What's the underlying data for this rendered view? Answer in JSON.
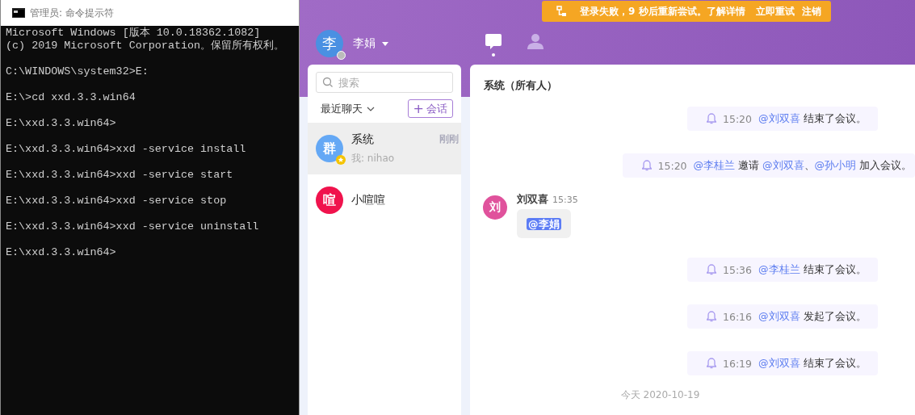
{
  "console": {
    "title": "管理员: 命令提示符",
    "blocks": [
      [
        "Microsoft Windows [版本 10.0.18362.1082]",
        "(c) 2019 Microsoft Corporation。保留所有权利。"
      ],
      [
        "C:\\WINDOWS\\system32>E:"
      ],
      [
        "E:\\>cd xxd.3.3.win64"
      ],
      [
        "E:\\xxd.3.3.win64>"
      ],
      [
        "E:\\xxd.3.3.win64>xxd -service install"
      ],
      [
        "E:\\xxd.3.3.win64>xxd -service start"
      ],
      [
        "E:\\xxd.3.3.win64>xxd -service stop"
      ],
      [
        "E:\\xxd.3.3.win64>xxd -service uninstall"
      ],
      [
        "E:\\xxd.3.3.win64>"
      ]
    ]
  },
  "app": {
    "user": {
      "avatar": "李",
      "name": "李娟",
      "online": false
    },
    "nav_tabs": [
      {
        "kind": "chat",
        "selected": true
      },
      {
        "kind": "contacts",
        "selected": false
      }
    ],
    "banner": {
      "message": "登录失败，9 秒后重新尝试。了解详情",
      "actions": [
        "立即重试",
        "注销"
      ]
    },
    "sidebar": {
      "search": {
        "placeholder": "搜索"
      },
      "filter": "最近聊天",
      "new_button": {
        "icon": "+",
        "label": "会话"
      },
      "conversations": [
        {
          "avatar": "群",
          "color": "#64a8f5",
          "name": "系统",
          "preview": "我: nihao",
          "time": "刚刚",
          "starred": true,
          "selected": true
        },
        {
          "avatar": "喧",
          "color": "#f0134d",
          "name": "小喧喧",
          "starred": false,
          "selected": false
        }
      ]
    },
    "chat": {
      "title": "系统（所有人）",
      "messages": [
        {
          "kind": "system",
          "time": "15:20",
          "parts": [
            {
              "kind": "mention",
              "text": "@刘双喜"
            },
            {
              "kind": "text",
              "text": "结束了会议。"
            }
          ]
        },
        {
          "kind": "system",
          "time": "15:20",
          "parts": [
            {
              "kind": "mention",
              "text": "@李桂兰"
            },
            {
              "kind": "text",
              "text": "邀请"
            },
            {
              "kind": "mention",
              "text": "@刘双喜"
            },
            {
              "kind": "text",
              "text": "、"
            },
            {
              "kind": "mention",
              "text": "@孙小明"
            },
            {
              "kind": "text",
              "text": "加入会议。"
            }
          ]
        },
        {
          "kind": "user",
          "avatar": "刘",
          "color": "#e0529c",
          "sender": "刘双喜",
          "time": "15:35",
          "mention": "@李娟"
        },
        {
          "kind": "system",
          "time": "15:36",
          "parts": [
            {
              "kind": "mention",
              "text": "@李桂兰"
            },
            {
              "kind": "text",
              "text": "结束了会议。"
            }
          ]
        },
        {
          "kind": "system",
          "time": "16:16",
          "parts": [
            {
              "kind": "mention",
              "text": "@刘双喜"
            },
            {
              "kind": "text",
              "text": "发起了会议。"
            }
          ]
        },
        {
          "kind": "system",
          "time": "16:19",
          "parts": [
            {
              "kind": "mention",
              "text": "@刘双喜"
            },
            {
              "kind": "text",
              "text": "结束了会议。"
            }
          ]
        }
      ],
      "date_divider": "今天 2020-10-19"
    }
  }
}
